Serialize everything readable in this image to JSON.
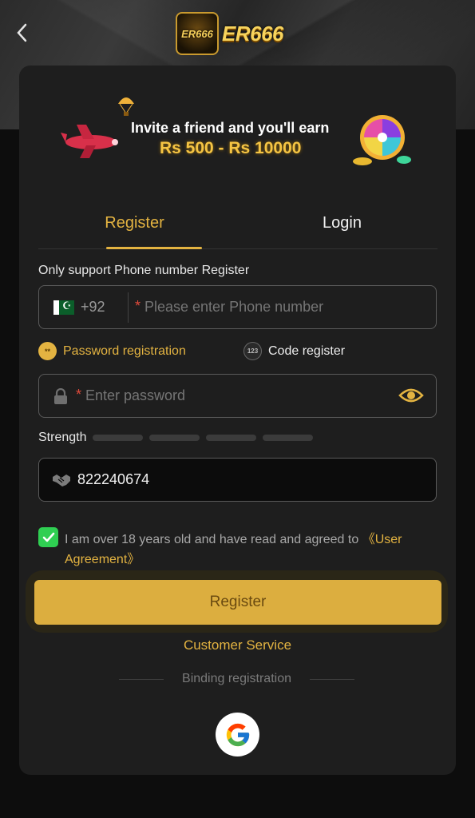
{
  "header": {
    "logo_badge_text": "ER666",
    "logo_text": "ER666"
  },
  "banner": {
    "line1": "Invite a friend and you'll earn",
    "line2": "Rs 500 - Rs 10000"
  },
  "tabs": [
    {
      "label": "Register",
      "active": true
    },
    {
      "label": "Login",
      "active": false
    }
  ],
  "form": {
    "hint": "Only support Phone number Register",
    "phone": {
      "country_code": "+92",
      "required_mark": "*",
      "placeholder": "Please enter Phone number",
      "value": ""
    },
    "options": {
      "password": {
        "icon_text": "**",
        "label": "Password registration",
        "selected": true
      },
      "code": {
        "icon_text": "123",
        "label": "Code register",
        "selected": false
      }
    },
    "password": {
      "required_mark": "*",
      "placeholder": "Enter password",
      "value": ""
    },
    "strength": {
      "label": "Strength",
      "level": 0,
      "segments": 4
    },
    "invite_code": {
      "value": "822240674"
    },
    "agreement": {
      "checked": true,
      "text": "I am over 18 years old and have read and agreed to ",
      "link": "《User Agreement》"
    },
    "register_button": "Register",
    "customer_service": "Customer Service",
    "binding_label": "Binding registration"
  },
  "colors": {
    "accent": "#e3b341",
    "button": "#dcae3f",
    "card": "#1e1e1e",
    "checkbox": "#2fcf52",
    "required": "#e24a3b"
  },
  "icons": [
    "chevron-left-icon",
    "pakistan-flag-icon",
    "lock-icon",
    "eye-icon",
    "handshake-icon",
    "check-icon",
    "google-icon"
  ]
}
